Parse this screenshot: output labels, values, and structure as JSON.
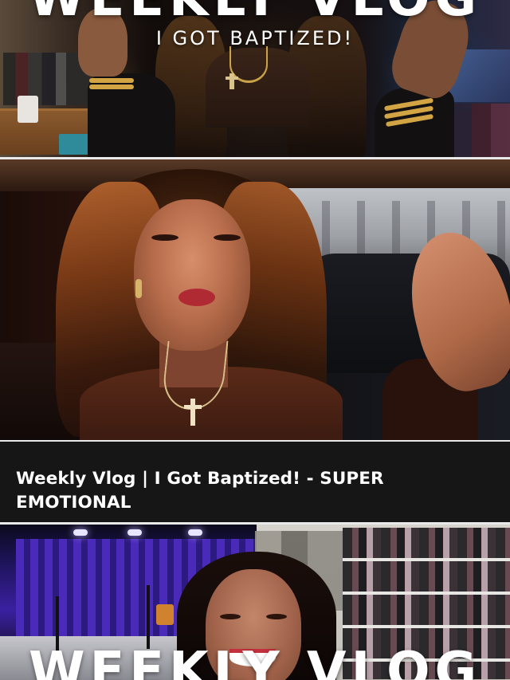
{
  "overlay": {
    "banner_top": "WEEKLY VLOG",
    "subtitle": "I GOT BAPTIZED!",
    "banner_bottom": "WEEKLY VLOG"
  },
  "video": {
    "title": "Weekly Vlog | I Got Baptized! - SUPER EMOTIONAL"
  },
  "colors": {
    "background": "#0c0c0c",
    "title_card": "#161616",
    "text": "#ffffff",
    "studio_accent": "#3a20a0"
  }
}
